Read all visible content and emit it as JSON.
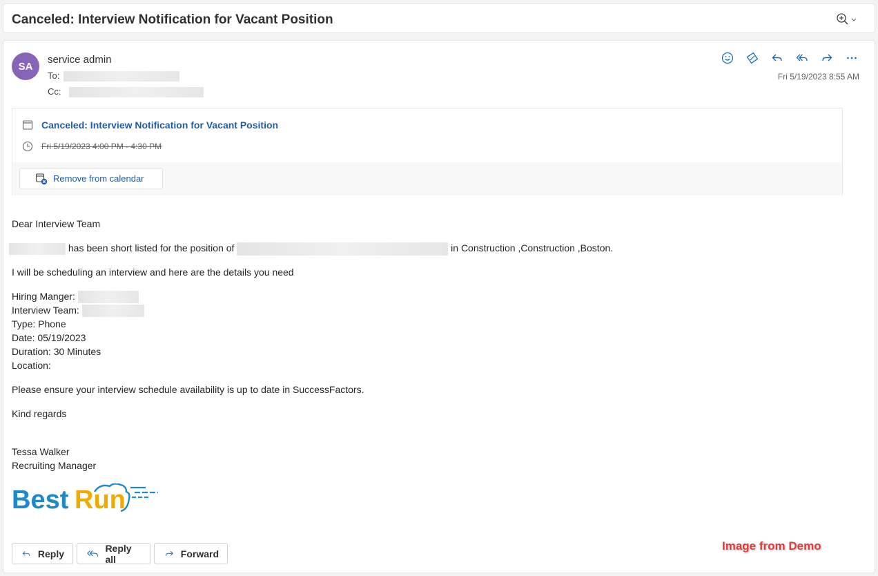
{
  "subject": "Canceled: Interview Notification for Vacant Position",
  "sender": {
    "initials": "SA",
    "name": "service admin",
    "to_label": "To:",
    "cc_label": "Cc:",
    "date": "Fri 5/19/2023 8:55 AM",
    "avatar_color": "#8764b8"
  },
  "actions": [
    "smiley-icon",
    "tag-icon",
    "reply-icon",
    "reply-all-icon",
    "forward-icon",
    "more-icon"
  ],
  "invite": {
    "title": "Canceled: Interview Notification for Vacant Position",
    "time": "Fri 5/19/2023 4:00 PM - 4:30 PM",
    "remove_label": "Remove from calendar"
  },
  "message": {
    "greeting": "Dear Interview Team",
    "shortlist_mid": "has been short listed for the position of",
    "shortlist_end": "in Construction ,Construction ,Boston.",
    "scheduling": "I will be scheduling an interview and here are the details you need",
    "hiring_manager_label": "Hiring Manger:",
    "interview_team_label": "Interview Team:",
    "type": "Type: Phone",
    "date": "Date: 05/19/2023",
    "duration": "Duration: 30 Minutes",
    "location": "Location:",
    "ensure": "Please ensure your interview schedule availability is up to date in SuccessFactors.",
    "regards": "Kind regards",
    "signer_name": "Tessa Walker",
    "signer_title": "Recruiting Manager",
    "logo_text_1": "Best",
    "logo_text_2": "Run"
  },
  "buttons": {
    "reply": "Reply",
    "reply_all": "Reply all",
    "forward": "Forward"
  },
  "watermark": "Image from Demo",
  "colors": {
    "link": "#1f5ea8",
    "accent_icon": "#0f6cbd",
    "logo_blue": "#1e88c9",
    "logo_gold": "#f0ab00",
    "watermark": "#e03a3a"
  }
}
